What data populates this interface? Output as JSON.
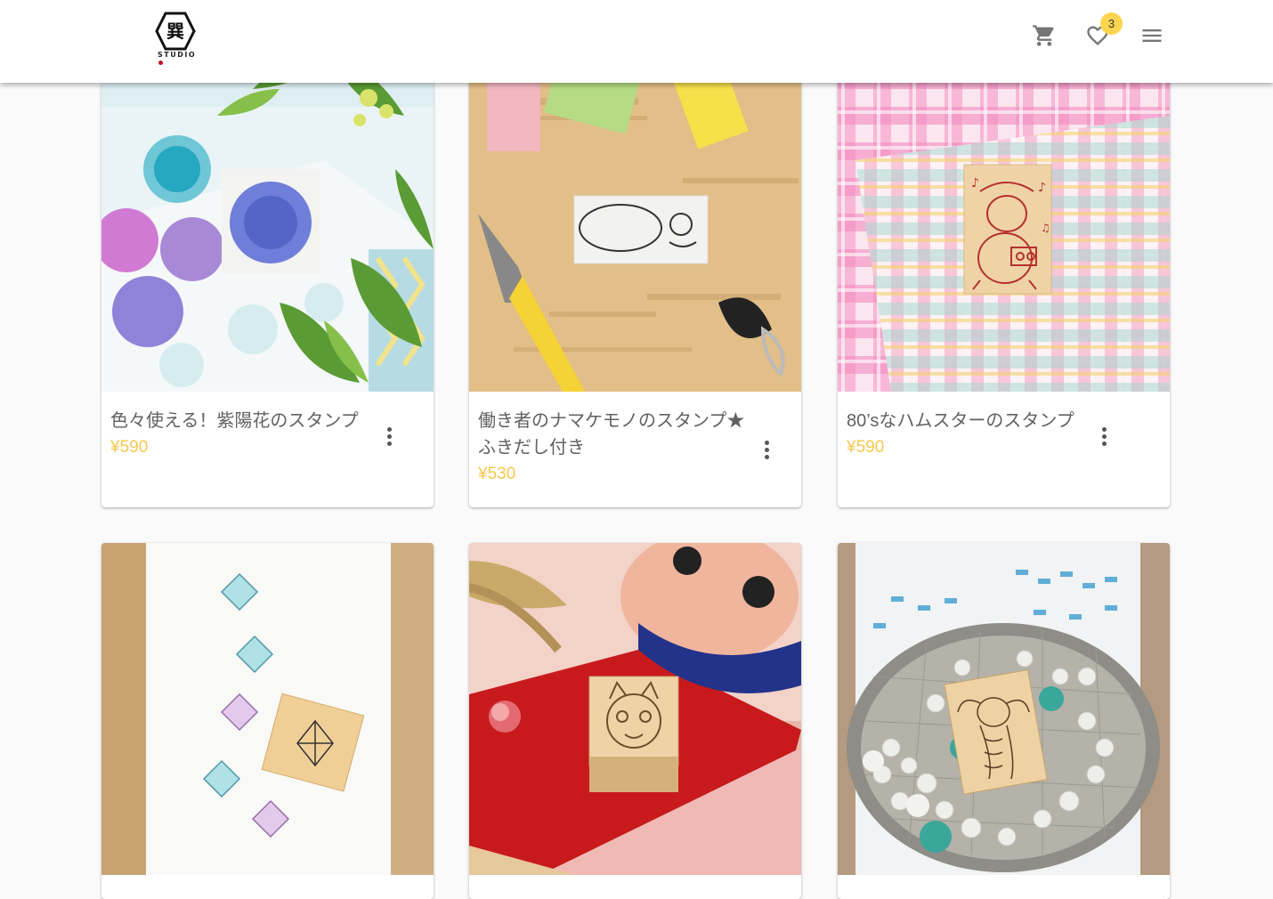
{
  "header": {
    "logo_text": "STUDIO",
    "favorites_count": "3"
  },
  "products": [
    {
      "title": "色々使える！紫陽花のスタンプ",
      "price": "¥590"
    },
    {
      "title": "働き者のナマケモノのスタンプ★ふきだし付き",
      "price": "¥530"
    },
    {
      "title": "80’sなハムスターのスタンプ",
      "price": "¥590"
    }
  ]
}
